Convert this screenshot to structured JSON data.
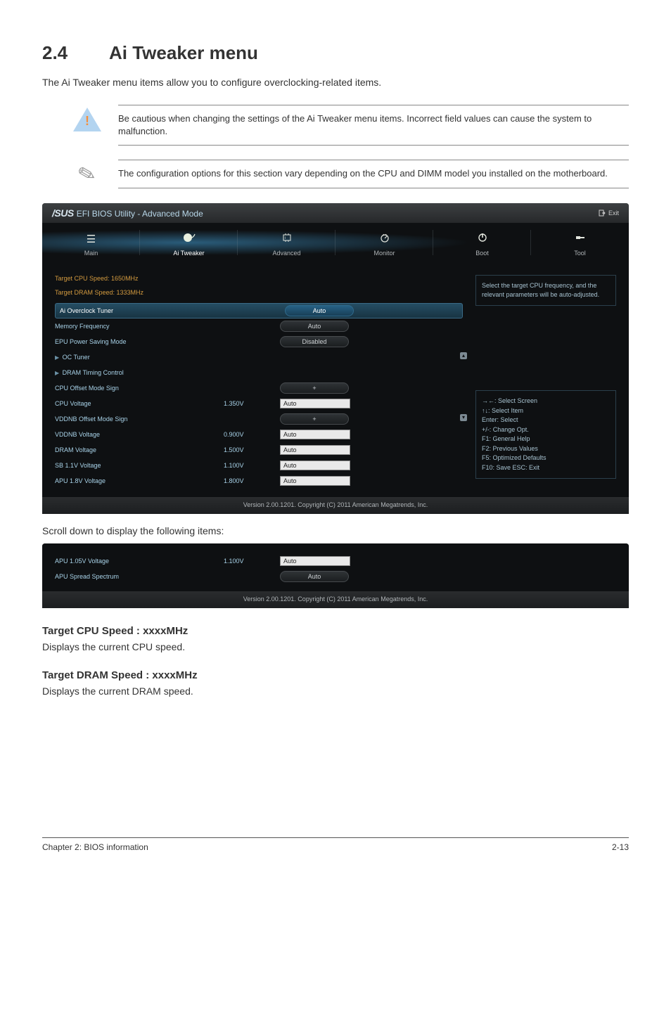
{
  "section": {
    "number": "2.4",
    "title": "Ai Tweaker menu",
    "intro": "The Ai Tweaker menu items allow you to configure overclocking-related items."
  },
  "callout_warning": "Be cautious when changing the settings of the Ai Tweaker menu items. Incorrect field values can cause the system to malfunction.",
  "callout_note": "The configuration options for this section vary depending on the CPU and DIMM model you installed on the motherboard.",
  "bios": {
    "brand": "/SUS",
    "title_rest": "EFI BIOS Utility - Advanced Mode",
    "exit": "Exit",
    "tabs": {
      "main": "Main",
      "ai_tweaker": "Ai  Tweaker",
      "advanced": "Advanced",
      "monitor": "Monitor",
      "boot": "Boot",
      "tool": "Tool"
    },
    "targets": {
      "cpu": "Target CPU Speed: 1650MHz",
      "dram": "Target DRAM Speed: 1333MHz"
    },
    "rows": {
      "ai_overclock_tuner": {
        "label": "Ai Overclock Tuner",
        "value": "Auto"
      },
      "memory_frequency": {
        "label": "Memory Frequency",
        "value": "Auto"
      },
      "epu_power_saving_mode": {
        "label": "EPU Power Saving Mode",
        "value": "Disabled"
      },
      "oc_tuner": {
        "label": "OC Tuner"
      },
      "dram_timing_control": {
        "label": "DRAM Timing Control"
      },
      "cpu_offset_mode_sign": {
        "label": "CPU Offset Mode Sign",
        "value": "+"
      },
      "cpu_voltage": {
        "label": "CPU Voltage",
        "reading": "1.350V",
        "value": "Auto"
      },
      "vddnb_offset_mode_sign": {
        "label": "VDDNB Offset Mode Sign",
        "value": "+"
      },
      "vddnb_voltage": {
        "label": "VDDNB Voltage",
        "reading": "0.900V",
        "value": "Auto"
      },
      "dram_voltage": {
        "label": "DRAM Voltage",
        "reading": "1.500V",
        "value": "Auto"
      },
      "sb_1_1v_voltage": {
        "label": "SB 1.1V Voltage",
        "reading": "1.100V",
        "value": "Auto"
      },
      "apu_1_8v_voltage": {
        "label": "APU 1.8V Voltage",
        "reading": "1.800V",
        "value": "Auto"
      }
    },
    "help_text": "Select the target CPU frequency, and the relevant parameters will be auto-adjusted.",
    "keys": {
      "k1": "→←: Select Screen",
      "k2": "↑↓: Select Item",
      "k3": "Enter: Select",
      "k4": "+/-: Change Opt.",
      "k5": "F1: General Help",
      "k6": "F2: Previous Values",
      "k7": "F5: Optimized Defaults",
      "k8": "F10: Save   ESC: Exit"
    },
    "footer": "Version  2.00.1201.   Copyright  (C)  2011  American  Megatrends,  Inc."
  },
  "scroll_note": "Scroll down to display the following items:",
  "bios2": {
    "rows": {
      "apu_1_05v": {
        "label": "APU 1.05V Voltage",
        "reading": "1.100V",
        "value": "Auto"
      },
      "apu_spread": {
        "label": "APU Spread Spectrum",
        "value": "Auto"
      }
    }
  },
  "sub1": {
    "heading": "Target CPU Speed : xxxxMHz",
    "text": "Displays the current CPU speed."
  },
  "sub2": {
    "heading": "Target DRAM Speed : xxxxMHz",
    "text": "Displays the current DRAM speed."
  },
  "footer": {
    "left": "Chapter 2: BIOS information",
    "right": "2-13"
  }
}
